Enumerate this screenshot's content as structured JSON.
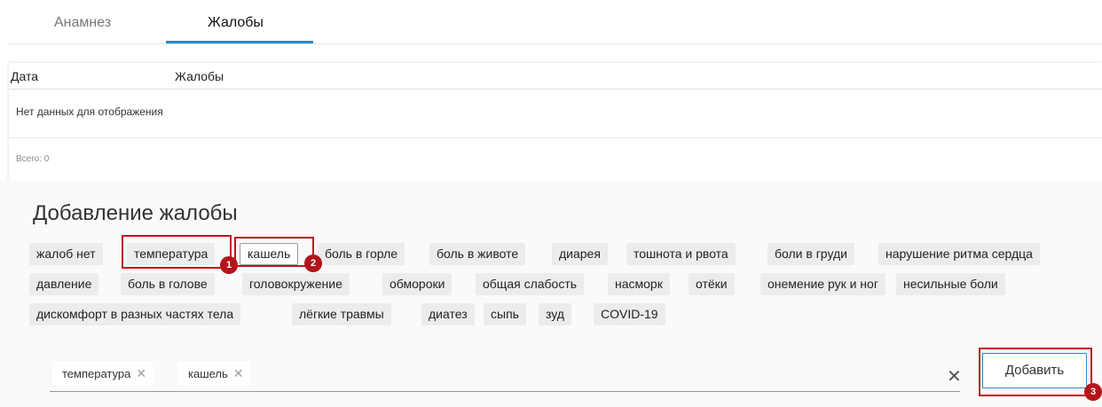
{
  "tabs": [
    {
      "label": "Анамнез"
    },
    {
      "label": "Жалобы"
    }
  ],
  "table": {
    "columns": [
      "Дата",
      "Жалобы"
    ],
    "empty_text": "Нет данных для отображения",
    "total": "Всего: 0"
  },
  "add": {
    "title": "Добавление жалобы",
    "tags": [
      "жалоб нет",
      "температура",
      "кашель",
      "боль в горле",
      "боль в животе",
      "диарея",
      "тошнота и рвота",
      "боли в груди",
      "нарушение ритма сердца",
      "давление",
      "боль в голове",
      "головокружение",
      "обмороки",
      "общая слабость",
      "насморк",
      "отёки",
      "онемение рук и ног",
      "несильные боли",
      "дискомфорт в разных частях тела",
      "лёгкие травмы",
      "диатез",
      "сыпь",
      "зуд",
      "COVID-19"
    ],
    "selected": [
      {
        "label": "температура",
        "remove": "✕"
      },
      {
        "label": "кашель",
        "remove": "✕"
      }
    ],
    "clear_icon": "✕",
    "button_label": "Добавить"
  },
  "annotations": {
    "badge1": "1",
    "badge2": "2",
    "badge3": "3",
    "highlight_color": "#c0141c"
  },
  "colors": {
    "accent": "#2b88c9",
    "tag_bg": "#ececec",
    "annotation": "#b3141b"
  }
}
